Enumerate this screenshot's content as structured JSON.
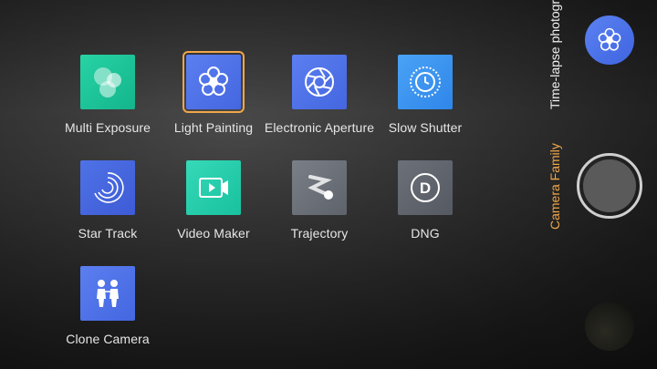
{
  "modes": [
    {
      "label": "Multi Exposure",
      "icon": "multi-exposure-icon",
      "color": "#1fc799"
    },
    {
      "label": "Light Painting",
      "icon": "light-painting-icon",
      "color": "#4f72e6",
      "selected": true
    },
    {
      "label": "Electronic Aperture",
      "icon": "aperture-icon",
      "color": "#4f72e6"
    },
    {
      "label": "Slow Shutter",
      "icon": "slow-shutter-icon",
      "color": "#2f86ea"
    },
    {
      "label": "Star Track",
      "icon": "star-track-icon",
      "color": "#3d5bd6"
    },
    {
      "label": "Video Maker",
      "icon": "video-maker-icon",
      "color": "#18c19f"
    },
    {
      "label": "Trajectory",
      "icon": "trajectory-icon",
      "color": "#6b7079"
    },
    {
      "label": "DNG",
      "icon": "dng-icon",
      "color": "#5e636b"
    },
    {
      "label": "Clone Camera",
      "icon": "clone-camera-icon",
      "color": "#4f72e6"
    }
  ],
  "side": {
    "top_mode": "Time-lapse photography",
    "current_mode": "Camera Family",
    "badge_icon": "light-painting-icon",
    "accent": "#f0a64a"
  }
}
